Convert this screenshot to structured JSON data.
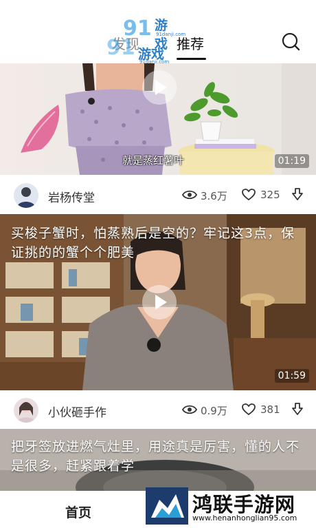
{
  "header": {
    "tab_discover": "发现",
    "tab_recommend": "推荐"
  },
  "watermark_top": {
    "text": "游戏",
    "url": "91danji.com",
    "number": "91"
  },
  "feed": [
    {
      "subtitle": "就是蒸红薯叶",
      "duration": "01:19",
      "author": "岩杨传堂",
      "views": "3.6万",
      "likes": "325"
    },
    {
      "title": "买梭子蟹时，怕蒸熟后是空的？牢记这3点，保证挑的的蟹个个肥美",
      "duration": "01:59",
      "author": "小伙砸手作",
      "views": "0.9万",
      "likes": "381"
    },
    {
      "title": "把牙签放进燃气灶里，用途真是厉害，懂的人不是很多，赶紧跟着学"
    }
  ],
  "bottom_nav": {
    "home": "首页"
  },
  "watermark_bottom": {
    "brand": "鸿联手游网",
    "domain": "www.henanhonglian95.com"
  }
}
